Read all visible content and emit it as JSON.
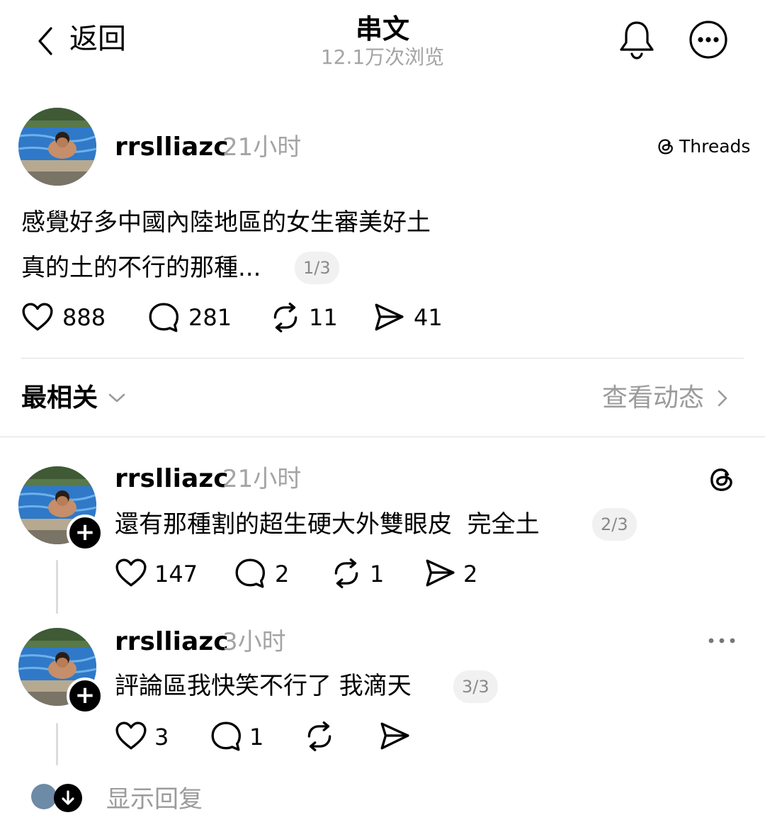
{
  "header": {
    "back_label": "返回",
    "title": "串文",
    "views": "12.1万次浏览"
  },
  "main_post": {
    "username": "rrslliazc",
    "time": "21小时",
    "brand": "Threads",
    "text_line1": "感覺好多中國內陸地區的女生審美好土",
    "text_line2": "真的土的不行的那種...",
    "pager": "1/3",
    "likes": "888",
    "comments": "281",
    "reposts": "11",
    "shares": "41"
  },
  "sort_bar": {
    "sort_label": "最相关",
    "activity_link": "查看动态"
  },
  "replies": [
    {
      "username": "rrslliazc",
      "time": "21小时",
      "text": "還有那種割的超生硬大外雙眼皮  完全土",
      "pager": "2/3",
      "likes": "147",
      "comments": "2",
      "reposts": "1",
      "shares": "2"
    },
    {
      "username": "rrslliazc",
      "time": "3小时",
      "text": "評論區我快笑不行了 我滴天",
      "pager": "3/3",
      "likes": "3",
      "comments": "1",
      "reposts": "",
      "shares": ""
    }
  ],
  "footer": {
    "show_replies": "显示回复"
  },
  "icons": {
    "back": "chevron-left-icon",
    "notification": "bell-icon",
    "more": "more-horizontal-icon",
    "like": "heart-icon",
    "comment": "comment-bubble-icon",
    "repost": "repost-icon",
    "share": "send-icon",
    "threads_logo": "threads-logo-icon"
  }
}
